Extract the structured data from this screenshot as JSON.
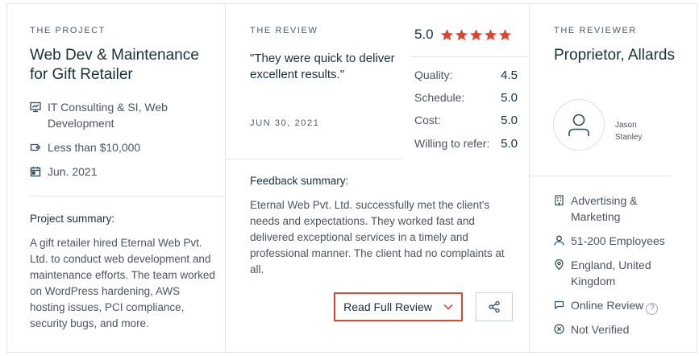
{
  "project": {
    "eyebrow": "THE PROJECT",
    "title": "Web Dev & Maintenance for Gift Retailer",
    "category": "IT Consulting & SI, Web Development",
    "budget": "Less than $10,000",
    "date": "Jun. 2021",
    "summary_heading": "Project summary:",
    "summary": "A gift retailer hired Eternal Web Pvt. Ltd. to conduct web development and maintenance efforts. The team worked on WordPress hardening, AWS hosting issues, PCI compliance, security bugs, and more."
  },
  "review": {
    "eyebrow": "THE REVIEW",
    "quote": "\"They were quick to deliver excellent results.\"",
    "date": "JUN 30, 2021",
    "overall": "5.0",
    "stars": 5,
    "star_color": "#e0432f",
    "scores": [
      {
        "label": "Quality:",
        "value": "4.5"
      },
      {
        "label": "Schedule:",
        "value": "5.0"
      },
      {
        "label": "Cost:",
        "value": "5.0"
      },
      {
        "label": "Willing to refer:",
        "value": "5.0"
      }
    ],
    "feedback_heading": "Feedback summary:",
    "feedback": "Eternal Web Pvt. Ltd. successfully met the client's needs and expectations. They worked fast and delivered exceptional services in a timely and professional manner. The client had no complaints at all.",
    "read_button": "Read Full Review",
    "share_icon": "share-icon"
  },
  "reviewer": {
    "eyebrow": "THE REVIEWER",
    "title": "Proprietor, Allards",
    "name": "Jason Stanley",
    "industry": "Advertising & Marketing",
    "size": "51-200 Employees",
    "location": "England, United Kingdom",
    "review_type": "Online Review",
    "verification": "Not Verified"
  },
  "colors": {
    "accent": "#e0432f",
    "text_dark": "#17313b",
    "text_muted": "#4a5560",
    "border": "#e0e5ea"
  }
}
